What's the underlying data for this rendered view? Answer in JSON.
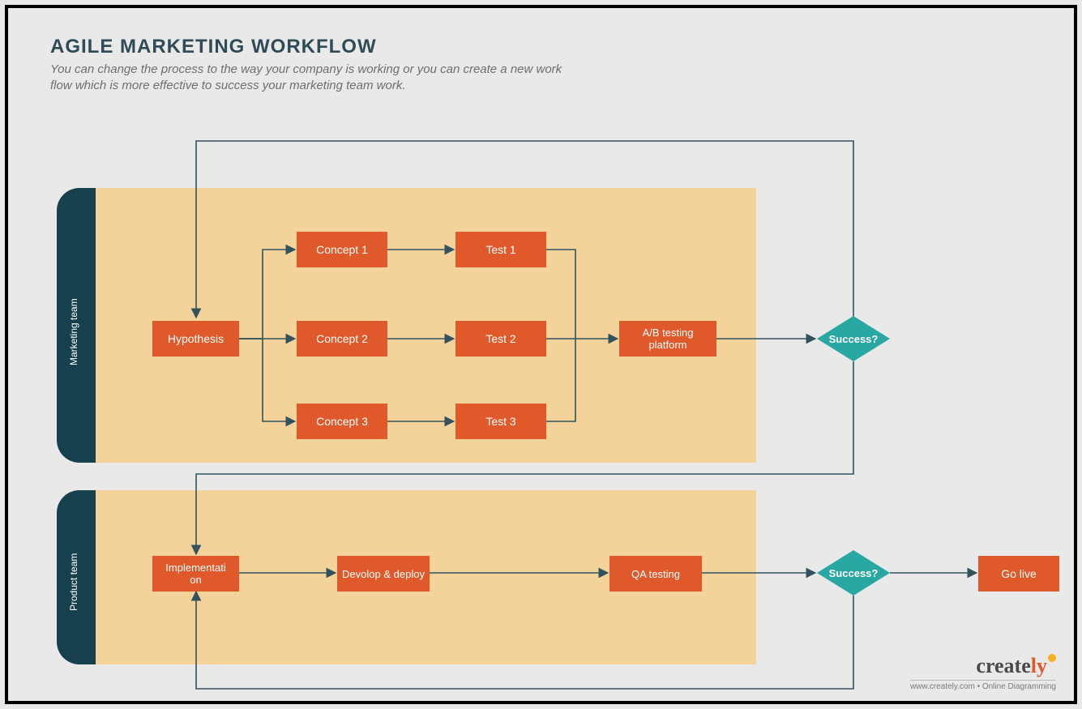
{
  "title": "AGILE MARKETING WORKFLOW",
  "subtitle": "You can change the process to the way your company is working or you can create a new work flow which is more effective to success your marketing team work.",
  "lanes": {
    "marketing": "Marketing team",
    "product": "Product team"
  },
  "nodes": {
    "hypothesis": "Hypothesis",
    "concept1": "Concept 1",
    "concept2": "Concept 2",
    "concept3": "Concept 3",
    "test1": "Test 1",
    "test2": "Test 2",
    "test3": "Test 3",
    "abtest": "A/B testing platform",
    "success1": "Success?",
    "implementation": "Implementati\non",
    "devdeploy": "Devolop & deploy",
    "qatesting": "QA testing",
    "success2": "Success?",
    "golive": "Go live"
  },
  "brand": {
    "name_a": "create",
    "name_b": "ly",
    "tagline": "www.creately.com • Online Diagramming"
  },
  "colors": {
    "node": "#e0592a",
    "lane": "#f3d39a",
    "tab": "#17404f",
    "diamond": "#29a7a3",
    "stroke": "#33525d"
  }
}
